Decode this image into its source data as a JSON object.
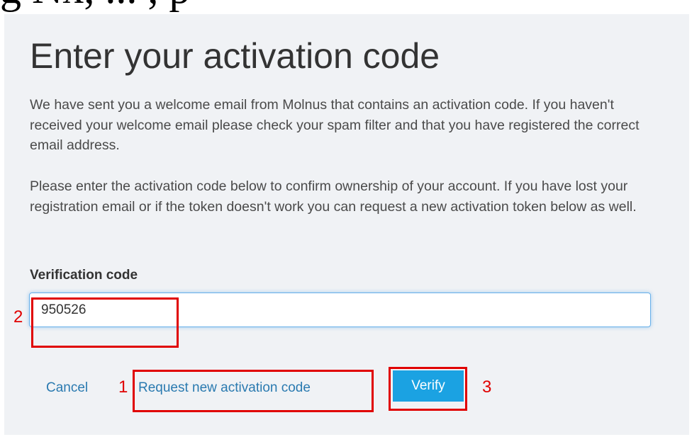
{
  "header_fragment": "g Nx, ... , p",
  "page": {
    "title": "Enter your activation code",
    "paragraph1": "We have sent you a welcome email from Molnus that contains an activation code. If you haven't received your welcome email please check your spam filter and that you have registered the correct email address.",
    "paragraph2": "Please enter the activation code below to confirm ownership of your account. If you have lost your registration email or if the token doesn't work you can request a new activation token below as well."
  },
  "form": {
    "verification_label": "Verification code",
    "verification_value": "950526"
  },
  "actions": {
    "cancel_label": "Cancel",
    "request_label": "Request new activation code",
    "verify_label": "Verify"
  },
  "annotations": {
    "request_number": "1",
    "input_number": "2",
    "verify_number": "3",
    "marker_color": "#e00000"
  },
  "colors": {
    "link": "#2a7ab0",
    "button": "#1ba2e2",
    "panel_bg": "#f0f2f5"
  }
}
